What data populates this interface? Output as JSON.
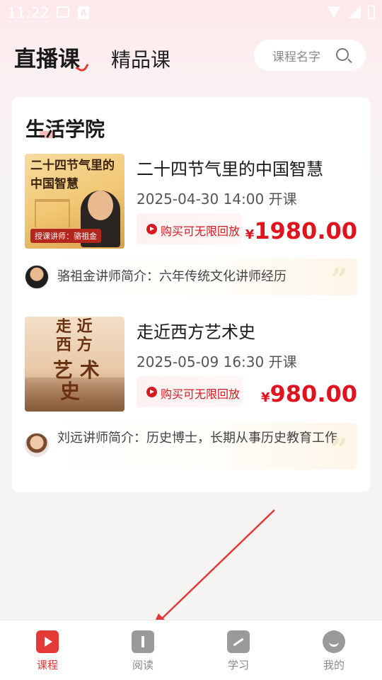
{
  "status_bar": {
    "time": "11:22",
    "a_icon_text": "A"
  },
  "header": {
    "tabs": [
      {
        "label": "直播课",
        "active": true
      },
      {
        "label": "精品课",
        "active": false
      }
    ],
    "search": {
      "placeholder": "课程名字"
    }
  },
  "section": {
    "title": "生活学院",
    "courses": [
      {
        "title": "二十四节气里的中国智慧",
        "thumb_title": "二十四节气里的中国智慧",
        "thumb_lecturer": "授课讲师：骆祖金",
        "datetime": "2025-04-30 14:00 开课",
        "replay": "购买可无限回放",
        "currency": "¥",
        "price": "1980.00",
        "teacher_intro": "骆祖金讲师简介：六年传统文化讲师经历"
      },
      {
        "title": "走近西方艺术史",
        "thumb_title": "走近西方艺术史",
        "datetime": "2025-05-09 16:30 开课",
        "replay": "购买可无限回放",
        "currency": "¥",
        "price": "980.00",
        "teacher_intro": "刘远讲师简介：历史博士，长期从事历史教育工作"
      }
    ]
  },
  "bottom_nav": [
    {
      "label": "课程",
      "icon": "video-play-icon",
      "active": true
    },
    {
      "label": "阅读",
      "icon": "book-icon",
      "active": false
    },
    {
      "label": "学习",
      "icon": "study-chart-icon",
      "active": false
    },
    {
      "label": "我的",
      "icon": "smiley-profile-icon",
      "active": false
    }
  ],
  "colors": {
    "accent": "#e53935",
    "price": "#e0141f",
    "inactive": "#888888"
  }
}
